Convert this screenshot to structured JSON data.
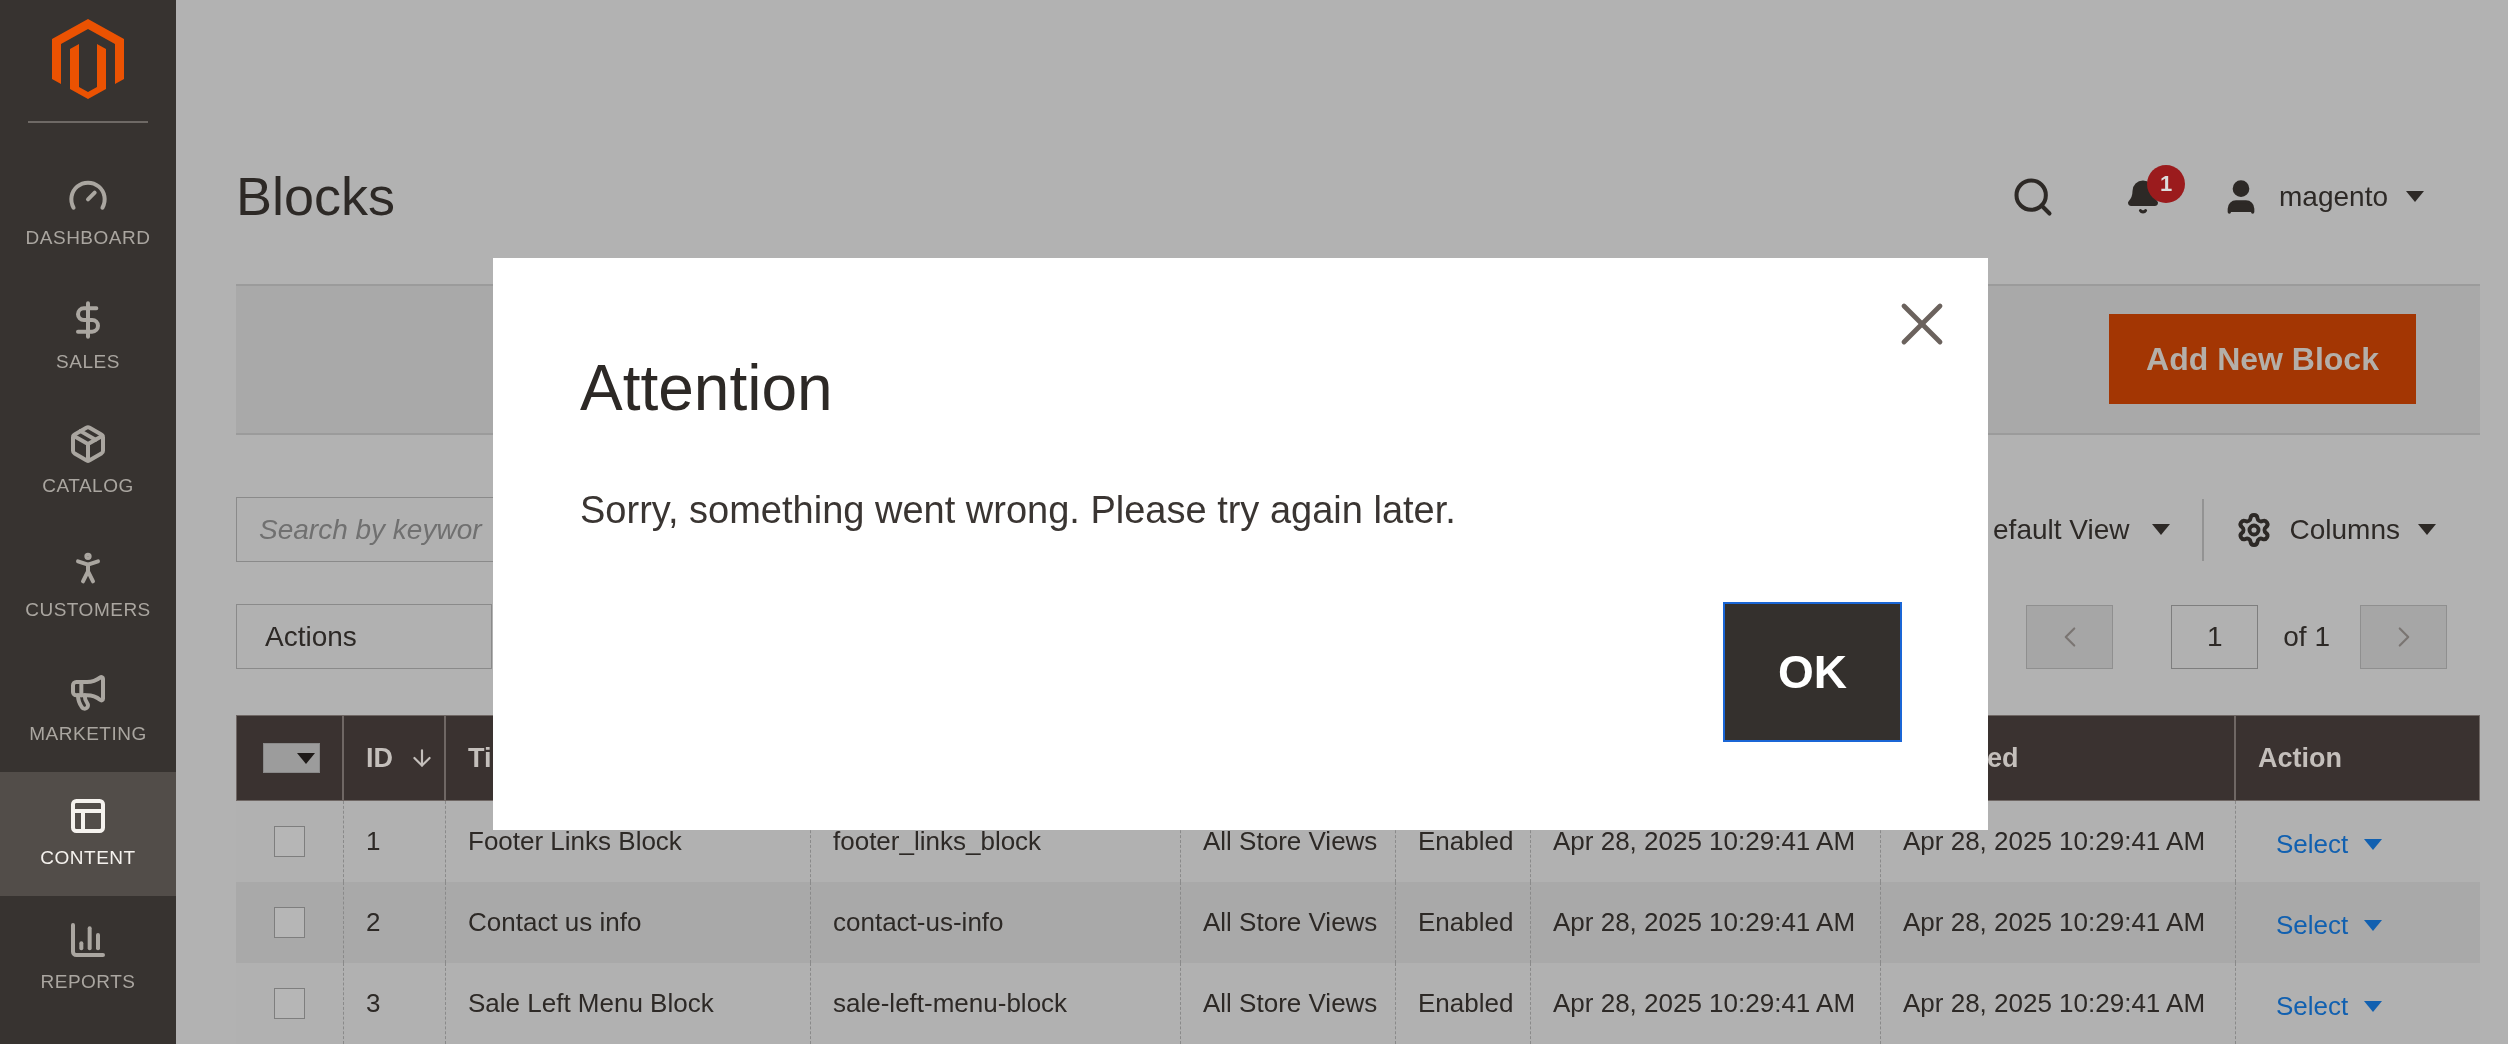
{
  "sidebar": {
    "items": [
      {
        "label": "DASHBOARD",
        "selected": false
      },
      {
        "label": "SALES",
        "selected": false
      },
      {
        "label": "CATALOG",
        "selected": false
      },
      {
        "label": "CUSTOMERS",
        "selected": false
      },
      {
        "label": "MARKETING",
        "selected": false
      },
      {
        "label": "CONTENT",
        "selected": true
      },
      {
        "label": "REPORTS",
        "selected": false
      }
    ]
  },
  "header": {
    "title": "Blocks",
    "notification_count": "1",
    "user": "magento"
  },
  "page_actions": {
    "add_button": "Add New Block"
  },
  "toolbar": {
    "search": {
      "placeholder": "Search by keywor"
    },
    "view": "efault View",
    "columns": "Columns",
    "actions": "Actions",
    "page": "1",
    "page_total": "of 1"
  },
  "table": {
    "header": {
      "id": "ID",
      "column_3": "Ti",
      "column_8": "ed",
      "action": "Action"
    },
    "rows": [
      {
        "checked": false,
        "cells": [
          "1",
          "Footer Links Block",
          "footer_links_block",
          "All Store Views",
          "Enabled",
          "Apr 28, 2025 10:29:41 AM",
          "Apr 28, 2025 10:29:41 AM"
        ],
        "action": "Select"
      },
      {
        "checked": false,
        "cells": [
          "2",
          "Contact us info",
          "contact-us-info",
          "All Store Views",
          "Enabled",
          "Apr 28, 2025 10:29:41 AM",
          "Apr 28, 2025 10:29:41 AM"
        ],
        "action": "Select"
      },
      {
        "checked": false,
        "cells": [
          "3",
          "Sale Left Menu Block",
          "sale-left-menu-block",
          "All Store Views",
          "Enabled",
          "Apr 28, 2025 10:29:41 AM",
          "Apr 28, 2025 10:29:41 AM"
        ],
        "action": "Select"
      }
    ]
  },
  "modal": {
    "title": "Attention",
    "message": "Sorry, something went wrong. Please try again later.",
    "ok_button": "OK"
  }
}
